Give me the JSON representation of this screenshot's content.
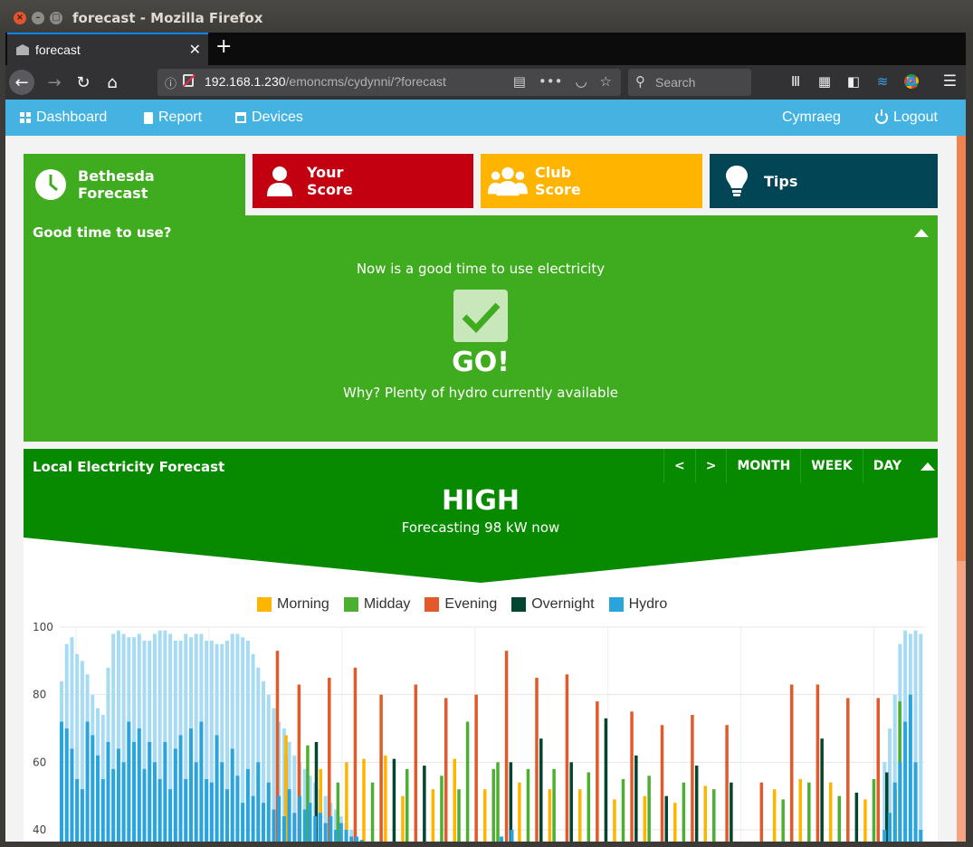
{
  "window": {
    "title": "forecast - Mozilla Firefox"
  },
  "browser": {
    "tab_label": "forecast",
    "url_host": "192.168.1.230",
    "url_path": "/emoncms/cydynni/?forecast",
    "search_placeholder": "Search"
  },
  "topnav": {
    "dashboard": "Dashboard",
    "report": "Report",
    "devices": "Devices",
    "language": "Cymraeg",
    "logout": "Logout"
  },
  "cards": [
    {
      "line1": "Bethesda",
      "line2": "Forecast",
      "color": "#3fab1e"
    },
    {
      "line1": "Your",
      "line2": "Score",
      "color": "#c3000f"
    },
    {
      "line1": "Club",
      "line2": "Score",
      "color": "#ffb400"
    },
    {
      "line1": "Tips",
      "line2": "",
      "color": "#024555"
    }
  ],
  "good_panel": {
    "title": "Good time to use?",
    "message": "Now is a good time to use electricity",
    "status": "GO!",
    "reason": "Why? Plenty of hydro currently available"
  },
  "forecast_panel": {
    "title": "Local Electricity Forecast",
    "prev": "<",
    "next": ">",
    "month": "MONTH",
    "week": "WEEK",
    "day": "DAY",
    "level": "HIGH",
    "now_text": "Forecasting 98 kW now"
  },
  "chart_data": {
    "type": "bar",
    "series": [
      {
        "name": "Morning",
        "color": "#ffb400"
      },
      {
        "name": "Midday",
        "color": "#4caf32"
      },
      {
        "name": "Evening",
        "color": "#e25a2a"
      },
      {
        "name": "Overnight",
        "color": "#024530"
      },
      {
        "name": "Hydro",
        "color": "#29a4dd"
      }
    ],
    "yticks": [
      40,
      60,
      80,
      100
    ],
    "ylim": [
      35,
      100
    ],
    "grid": true,
    "hydro_shade_color": "#a6dbf3",
    "hydro_values": [
      72,
      70,
      64,
      55,
      52,
      72,
      68,
      62,
      55,
      66,
      58,
      64,
      60,
      72,
      66,
      70,
      58,
      66,
      60,
      55,
      66,
      52,
      64,
      68,
      55,
      70,
      60,
      72,
      55,
      54,
      68,
      60,
      52,
      64,
      56,
      48,
      58,
      50,
      60,
      48,
      54,
      46,
      50,
      44,
      52,
      45,
      50,
      46,
      48,
      44,
      45,
      42,
      44,
      40,
      42,
      40,
      38,
      38,
      37,
      36,
      35,
      34,
      35,
      34,
      36,
      34,
      35,
      34,
      36,
      34,
      35,
      34,
      36,
      35,
      34,
      36,
      34,
      35,
      34,
      36,
      34,
      35,
      34,
      36,
      34,
      38,
      36,
      40,
      35,
      34,
      36,
      34,
      35,
      34,
      36,
      34,
      35,
      34,
      36,
      34,
      35,
      34,
      36,
      34,
      35,
      34,
      36,
      34,
      35,
      34,
      36,
      34,
      35,
      34,
      36,
      34,
      35,
      34,
      36,
      34,
      35,
      34,
      36,
      34,
      35,
      34,
      36,
      34,
      35,
      34,
      36,
      34,
      35,
      34,
      36,
      34,
      35,
      34,
      36,
      34,
      35,
      34,
      36,
      34,
      35,
      34,
      36,
      34,
      35,
      34,
      36,
      34,
      35,
      34,
      36,
      34,
      35,
      34,
      36,
      40,
      45,
      54,
      60,
      72,
      80,
      60,
      40
    ],
    "hydro_shade": [
      84,
      95,
      97,
      92,
      90,
      86,
      80,
      76,
      74,
      88,
      98,
      99,
      98,
      97,
      97,
      98,
      96,
      96,
      98,
      99,
      99,
      98,
      96,
      96,
      98,
      97,
      98,
      98,
      96,
      96,
      95,
      95,
      96,
      98,
      98,
      97,
      96,
      92,
      88,
      84,
      80,
      76,
      72,
      70,
      66,
      62,
      60,
      58,
      56,
      54,
      52,
      50,
      48,
      46,
      44,
      42,
      40,
      38,
      37,
      36
    ],
    "tariff_bars": [
      {
        "x": 0.25,
        "v": 93,
        "s": 2
      },
      {
        "x": 0.26,
        "v": 62,
        "s": 2
      },
      {
        "x": 0.26,
        "v": 68,
        "s": 0
      },
      {
        "x": 0.275,
        "v": 83,
        "s": 2
      },
      {
        "x": 0.285,
        "v": 65,
        "s": 1
      },
      {
        "x": 0.295,
        "v": 66,
        "s": 3
      },
      {
        "x": 0.3,
        "v": 58,
        "s": 0
      },
      {
        "x": 0.31,
        "v": 85,
        "s": 2
      },
      {
        "x": 0.32,
        "v": 54,
        "s": 1
      },
      {
        "x": 0.33,
        "v": 60,
        "s": 0
      },
      {
        "x": 0.34,
        "v": 88,
        "s": 2
      },
      {
        "x": 0.35,
        "v": 61,
        "s": 0
      },
      {
        "x": 0.36,
        "v": 54,
        "s": 1
      },
      {
        "x": 0.37,
        "v": 80,
        "s": 2
      },
      {
        "x": 0.375,
        "v": 62,
        "s": 0
      },
      {
        "x": 0.385,
        "v": 61,
        "s": 3
      },
      {
        "x": 0.395,
        "v": 50,
        "s": 0
      },
      {
        "x": 0.4,
        "v": 58,
        "s": 1
      },
      {
        "x": 0.41,
        "v": 83,
        "s": 2
      },
      {
        "x": 0.42,
        "v": 59,
        "s": 3
      },
      {
        "x": 0.43,
        "v": 52,
        "s": 0
      },
      {
        "x": 0.44,
        "v": 56,
        "s": 1
      },
      {
        "x": 0.445,
        "v": 79,
        "s": 2
      },
      {
        "x": 0.455,
        "v": 61,
        "s": 0
      },
      {
        "x": 0.46,
        "v": 52,
        "s": 1
      },
      {
        "x": 0.47,
        "v": 72,
        "s": 1
      },
      {
        "x": 0.48,
        "v": 80,
        "s": 2
      },
      {
        "x": 0.49,
        "v": 52,
        "s": 0
      },
      {
        "x": 0.5,
        "v": 58,
        "s": 1
      },
      {
        "x": 0.505,
        "v": 60,
        "s": 1
      },
      {
        "x": 0.515,
        "v": 93,
        "s": 2
      },
      {
        "x": 0.52,
        "v": 60,
        "s": 3
      },
      {
        "x": 0.53,
        "v": 54,
        "s": 0
      },
      {
        "x": 0.54,
        "v": 58,
        "s": 1
      },
      {
        "x": 0.55,
        "v": 85,
        "s": 2
      },
      {
        "x": 0.555,
        "v": 67,
        "s": 3
      },
      {
        "x": 0.565,
        "v": 52,
        "s": 0
      },
      {
        "x": 0.57,
        "v": 58,
        "s": 1
      },
      {
        "x": 0.585,
        "v": 86,
        "s": 2
      },
      {
        "x": 0.59,
        "v": 60,
        "s": 3
      },
      {
        "x": 0.6,
        "v": 52,
        "s": 0
      },
      {
        "x": 0.61,
        "v": 57,
        "s": 1
      },
      {
        "x": 0.62,
        "v": 78,
        "s": 2
      },
      {
        "x": 0.63,
        "v": 73,
        "s": 3
      },
      {
        "x": 0.64,
        "v": 49,
        "s": 0
      },
      {
        "x": 0.65,
        "v": 55,
        "s": 1
      },
      {
        "x": 0.66,
        "v": 75,
        "s": 2
      },
      {
        "x": 0.665,
        "v": 62,
        "s": 3
      },
      {
        "x": 0.675,
        "v": 50,
        "s": 0
      },
      {
        "x": 0.68,
        "v": 56,
        "s": 1
      },
      {
        "x": 0.695,
        "v": 71,
        "s": 2
      },
      {
        "x": 0.7,
        "v": 50,
        "s": 3
      },
      {
        "x": 0.71,
        "v": 48,
        "s": 0
      },
      {
        "x": 0.72,
        "v": 54,
        "s": 1
      },
      {
        "x": 0.73,
        "v": 74,
        "s": 2
      },
      {
        "x": 0.735,
        "v": 59,
        "s": 3
      },
      {
        "x": 0.745,
        "v": 53,
        "s": 0
      },
      {
        "x": 0.755,
        "v": 52,
        "s": 1
      },
      {
        "x": 0.77,
        "v": 71,
        "s": 2
      },
      {
        "x": 0.775,
        "v": 54,
        "s": 3
      },
      {
        "x": 0.81,
        "v": 54,
        "s": 2
      },
      {
        "x": 0.825,
        "v": 52,
        "s": 0
      },
      {
        "x": 0.835,
        "v": 49,
        "s": 1
      },
      {
        "x": 0.845,
        "v": 83,
        "s": 2
      },
      {
        "x": 0.855,
        "v": 55,
        "s": 0
      },
      {
        "x": 0.865,
        "v": 54,
        "s": 1
      },
      {
        "x": 0.875,
        "v": 83,
        "s": 2
      },
      {
        "x": 0.88,
        "v": 67,
        "s": 3
      },
      {
        "x": 0.89,
        "v": 54,
        "s": 0
      },
      {
        "x": 0.9,
        "v": 50,
        "s": 1
      },
      {
        "x": 0.91,
        "v": 79,
        "s": 2
      },
      {
        "x": 0.92,
        "v": 51,
        "s": 3
      },
      {
        "x": 0.93,
        "v": 49,
        "s": 0
      },
      {
        "x": 0.94,
        "v": 55,
        "s": 1
      },
      {
        "x": 0.945,
        "v": 79,
        "s": 2
      },
      {
        "x": 0.955,
        "v": 57,
        "s": 3
      },
      {
        "x": 0.965,
        "v": 52,
        "s": 0
      },
      {
        "x": 0.97,
        "v": 78,
        "s": 1
      }
    ]
  }
}
